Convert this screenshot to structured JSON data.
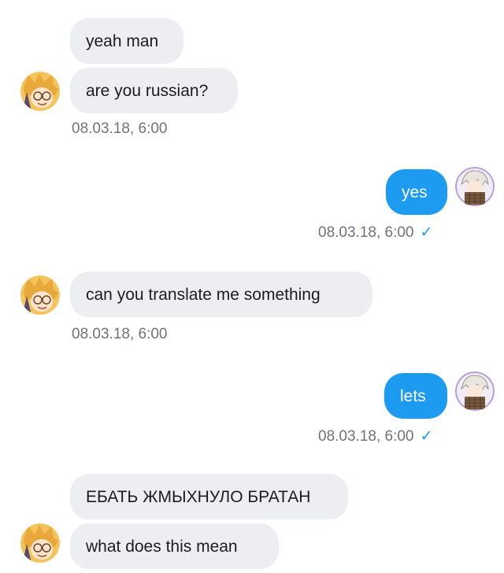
{
  "conversation": {
    "messages": [
      {
        "text": "yeah man",
        "direction": "incoming"
      },
      {
        "text": "are you russian?",
        "direction": "incoming"
      },
      {
        "text": "yes",
        "direction": "outgoing"
      },
      {
        "text": "can you translate me something",
        "direction": "incoming"
      },
      {
        "text": "lets",
        "direction": "outgoing"
      },
      {
        "text": "ЕБАТЬ ЖМЫХНУЛО БРАТАН",
        "direction": "incoming"
      },
      {
        "text": "what does this mean",
        "direction": "incoming"
      }
    ],
    "timestamps": [
      {
        "text": "08.03.18, 6:00",
        "read_mark": ""
      },
      {
        "text": "08.03.18, 6:00",
        "read_mark": "✓"
      },
      {
        "text": "08.03.18, 6:00",
        "read_mark": ""
      },
      {
        "text": "08.03.18, 6:00",
        "read_mark": "✓"
      }
    ]
  },
  "avatars": {
    "incoming": "blonde-anime-character-avatar",
    "outgoing": "white-haired-anime-character-avatar"
  },
  "colors": {
    "incoming_bubble": "#eceef2",
    "outgoing_bubble": "#1d9bf0",
    "timestamp_text": "#6f7378",
    "read_check": "#1d9bf0"
  }
}
